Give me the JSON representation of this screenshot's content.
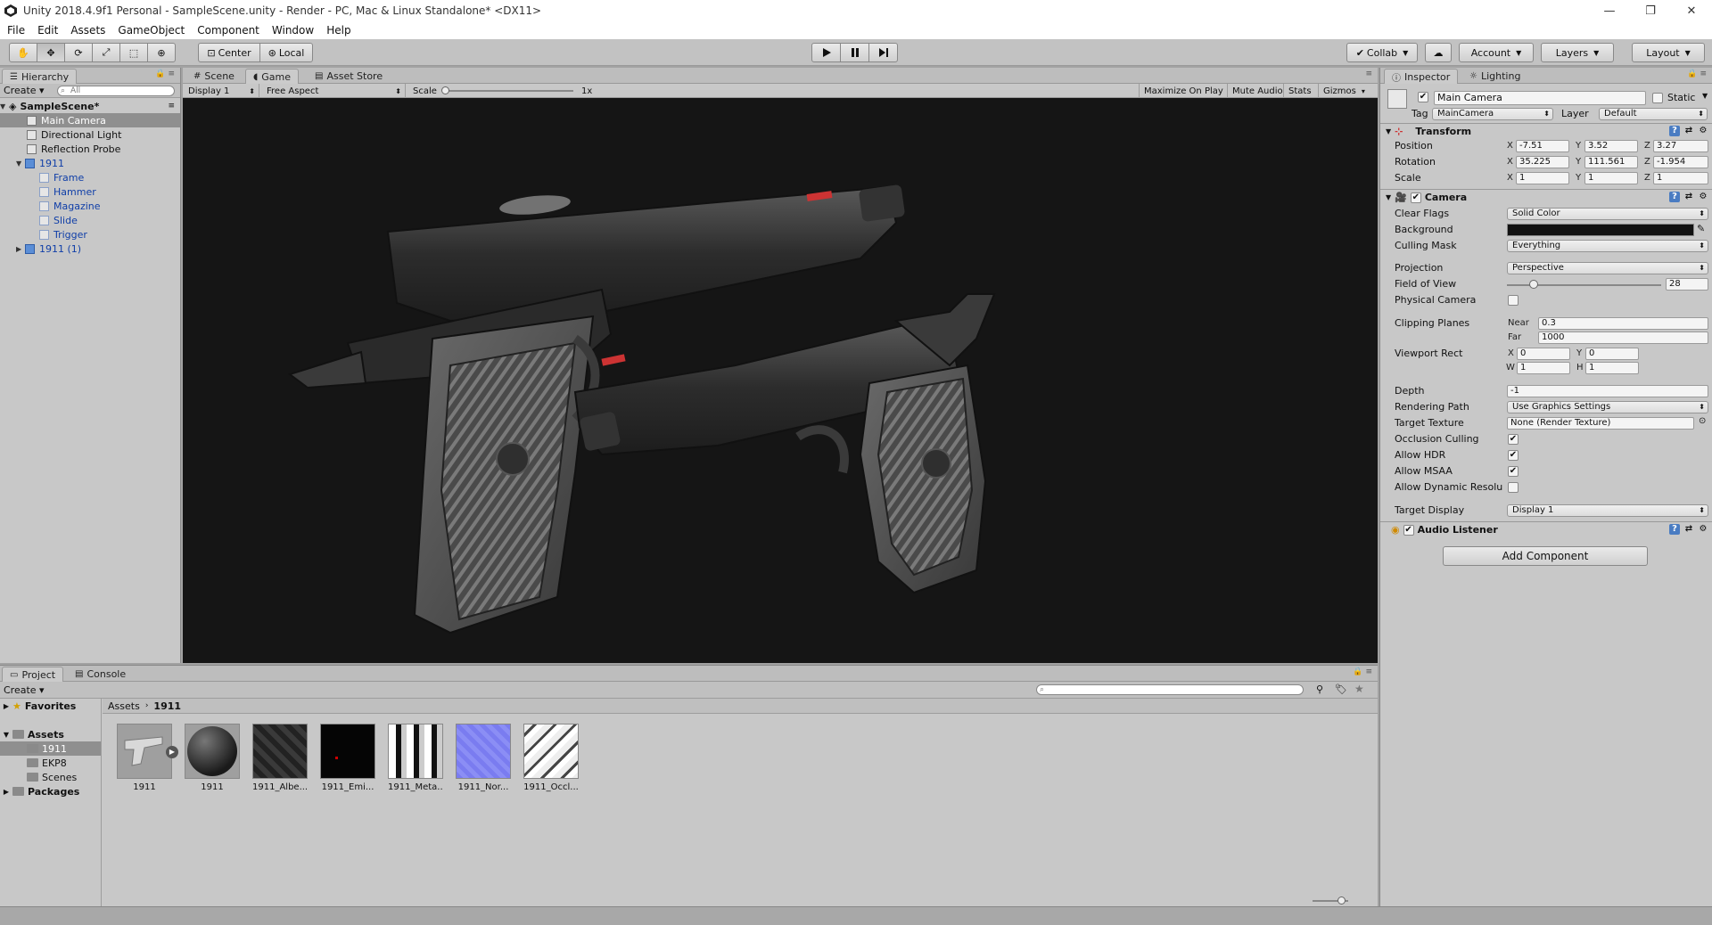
{
  "window": {
    "title": "Unity 2018.4.9f1 Personal - SampleScene.unity - Render - PC, Mac & Linux Standalone* <DX11>",
    "controls": [
      "—",
      "❐",
      "✕"
    ]
  },
  "menu": [
    "File",
    "Edit",
    "Assets",
    "GameObject",
    "Component",
    "Window",
    "Help"
  ],
  "toolbar": {
    "pivot": "Center",
    "space": "Local",
    "collab": "Collab",
    "account": "Account",
    "layers": "Layers",
    "layout": "Layout"
  },
  "hierarchy": {
    "tab": "Hierarchy",
    "create": "Create",
    "search_placeholder": "All",
    "scene": "SampleScene*",
    "items": [
      {
        "label": "Main Camera",
        "selected": true
      },
      {
        "label": "Directional Light"
      },
      {
        "label": "Reflection Probe"
      },
      {
        "label": "1911"
      },
      {
        "label": "Frame"
      },
      {
        "label": "Hammer"
      },
      {
        "label": "Magazine"
      },
      {
        "label": "Slide"
      },
      {
        "label": "Trigger"
      },
      {
        "label": "1911 (1)"
      }
    ]
  },
  "center_tabs": [
    "Scene",
    "Game",
    "Asset Store"
  ],
  "game": {
    "display": "Display 1",
    "aspect": "Free Aspect",
    "scale_label": "Scale",
    "scale_value": "1x",
    "buttons": [
      "Maximize On Play",
      "Mute Audio",
      "Stats",
      "Gizmos"
    ]
  },
  "inspector": {
    "tabs": [
      "Inspector",
      "Lighting"
    ],
    "object_name": "Main Camera",
    "static_label": "Static",
    "tag_label": "Tag",
    "tag_value": "MainCamera",
    "layer_label": "Layer",
    "layer_value": "Default",
    "transform": {
      "title": "Transform",
      "position_label": "Position",
      "position": [
        "-7.51",
        "3.52",
        "3.27"
      ],
      "rotation_label": "Rotation",
      "rotation": [
        "35.225",
        "111.561",
        "-1.954"
      ],
      "scale_label": "Scale",
      "scale": [
        "1",
        "1",
        "1"
      ]
    },
    "camera": {
      "title": "Camera",
      "clear_flags_label": "Clear Flags",
      "clear_flags": "Solid Color",
      "background_label": "Background",
      "background_color": "#111111",
      "culling_mask_label": "Culling Mask",
      "culling_mask": "Everything",
      "projection_label": "Projection",
      "projection": "Perspective",
      "fov_label": "Field of View",
      "fov": "28",
      "physical_label": "Physical Camera",
      "clipping_label": "Clipping Planes",
      "near_label": "Near",
      "near": "0.3",
      "far_label": "Far",
      "far": "1000",
      "viewport_label": "Viewport Rect",
      "vp_x": "0",
      "vp_y": "0",
      "vp_w": "1",
      "vp_h": "1",
      "depth_label": "Depth",
      "depth": "-1",
      "rendering_path_label": "Rendering Path",
      "rendering_path": "Use Graphics Settings",
      "target_texture_label": "Target Texture",
      "target_texture": "None (Render Texture)",
      "occlusion_label": "Occlusion Culling",
      "hdr_label": "Allow HDR",
      "msaa_label": "Allow MSAA",
      "dynres_label": "Allow Dynamic Resolu",
      "target_display_label": "Target Display",
      "target_display": "Display 1"
    },
    "audio_listener": "Audio Listener",
    "add_component": "Add Component"
  },
  "project": {
    "tabs": [
      "Project",
      "Console"
    ],
    "create": "Create",
    "tree": {
      "favorites": "Favorites",
      "assets": "Assets",
      "folders": [
        "1911",
        "EKP8",
        "Scenes"
      ],
      "packages": "Packages"
    },
    "breadcrumb": [
      "Assets",
      "1911"
    ],
    "assets": [
      {
        "label": "1911",
        "kind": "model"
      },
      {
        "label": "1911",
        "kind": "material"
      },
      {
        "label": "1911_Albe...",
        "kind": "texture-albedo"
      },
      {
        "label": "1911_Emi...",
        "kind": "texture-emission"
      },
      {
        "label": "1911_Meta...",
        "kind": "texture-metallic"
      },
      {
        "label": "1911_Nor...",
        "kind": "texture-normal"
      },
      {
        "label": "1911_Occl...",
        "kind": "texture-occlusion"
      }
    ]
  }
}
